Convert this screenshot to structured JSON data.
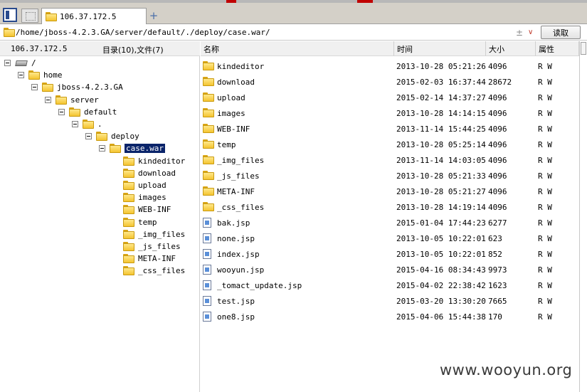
{
  "tabbar": {
    "active_tab_label": "106.37.172.5",
    "add_label": "+"
  },
  "address": {
    "path": "/home/jboss-4.2.3.GA/server/default/./deploy/case.war/",
    "pin_glyph": "±",
    "dropdown_glyph": "∨",
    "read_button_label": "读取"
  },
  "left_pane": {
    "host": "106.37.172.5",
    "counts_label": "目录(10),文件(7)",
    "tree": [
      {
        "label": "/",
        "icon": "drive-icon",
        "level": 0,
        "expander": true
      },
      {
        "label": "home",
        "icon": "folder-icon",
        "level": 1,
        "expander": true
      },
      {
        "label": "jboss-4.2.3.GA",
        "icon": "folder-icon",
        "level": 2,
        "expander": true
      },
      {
        "label": "server",
        "icon": "folder-icon",
        "level": 3,
        "expander": true
      },
      {
        "label": "default",
        "icon": "folder-icon",
        "level": 4,
        "expander": true
      },
      {
        "label": ".",
        "icon": "folder-icon",
        "level": 5,
        "expander": true
      },
      {
        "label": "deploy",
        "icon": "folder-icon",
        "level": 6,
        "expander": true
      },
      {
        "label": "case.war",
        "icon": "folder-icon",
        "level": 7,
        "expander": true,
        "selected": true
      },
      {
        "label": "kindeditor",
        "icon": "folder-icon",
        "level": 8,
        "expander": false
      },
      {
        "label": "download",
        "icon": "folder-icon",
        "level": 8,
        "expander": false
      },
      {
        "label": "upload",
        "icon": "folder-icon",
        "level": 8,
        "expander": false
      },
      {
        "label": "images",
        "icon": "folder-icon",
        "level": 8,
        "expander": false
      },
      {
        "label": "WEB-INF",
        "icon": "folder-icon",
        "level": 8,
        "expander": false
      },
      {
        "label": "temp",
        "icon": "folder-icon",
        "level": 8,
        "expander": false
      },
      {
        "label": "_img_files",
        "icon": "folder-icon",
        "level": 8,
        "expander": false
      },
      {
        "label": "_js_files",
        "icon": "folder-icon",
        "level": 8,
        "expander": false
      },
      {
        "label": "META-INF",
        "icon": "folder-icon",
        "level": 8,
        "expander": false
      },
      {
        "label": "_css_files",
        "icon": "folder-icon",
        "level": 8,
        "expander": false
      }
    ]
  },
  "file_list": {
    "columns": {
      "name": "名称",
      "time": "时间",
      "size": "大小",
      "attr": "属性"
    },
    "rows": [
      {
        "type": "folder",
        "name": "kindeditor",
        "time": "2013-10-28 05:21:26",
        "size": "4096",
        "attr": "R W"
      },
      {
        "type": "folder",
        "name": "download",
        "time": "2015-02-03 16:37:44",
        "size": "28672",
        "attr": "R W"
      },
      {
        "type": "folder",
        "name": "upload",
        "time": "2015-02-14 14:37:27",
        "size": "4096",
        "attr": "R W"
      },
      {
        "type": "folder",
        "name": "images",
        "time": "2013-10-28 14:14:15",
        "size": "4096",
        "attr": "R W"
      },
      {
        "type": "folder",
        "name": "WEB-INF",
        "time": "2013-11-14 15:44:25",
        "size": "4096",
        "attr": "R W"
      },
      {
        "type": "folder",
        "name": "temp",
        "time": "2013-10-28 05:25:14",
        "size": "4096",
        "attr": "R W"
      },
      {
        "type": "folder",
        "name": "_img_files",
        "time": "2013-11-14 14:03:05",
        "size": "4096",
        "attr": "R W"
      },
      {
        "type": "folder",
        "name": "_js_files",
        "time": "2013-10-28 05:21:33",
        "size": "4096",
        "attr": "R W"
      },
      {
        "type": "folder",
        "name": "META-INF",
        "time": "2013-10-28 05:21:27",
        "size": "4096",
        "attr": "R W"
      },
      {
        "type": "folder",
        "name": "_css_files",
        "time": "2013-10-28 14:19:14",
        "size": "4096",
        "attr": "R W"
      },
      {
        "type": "file",
        "name": "bak.jsp",
        "time": "2015-01-04 17:44:23",
        "size": "6277",
        "attr": "R W"
      },
      {
        "type": "file",
        "name": "none.jsp",
        "time": "2013-10-05 10:22:01",
        "size": "623",
        "attr": "R W"
      },
      {
        "type": "file",
        "name": "index.jsp",
        "time": "2013-10-05 10:22:01",
        "size": "852",
        "attr": "R W"
      },
      {
        "type": "file",
        "name": "wooyun.jsp",
        "time": "2015-04-16 08:34:43",
        "size": "9973",
        "attr": "R W"
      },
      {
        "type": "file",
        "name": "_tomact_update.jsp",
        "time": "2015-04-02 22:38:42",
        "size": "1623",
        "attr": "R W"
      },
      {
        "type": "file",
        "name": "test.jsp",
        "time": "2015-03-20 13:30:20",
        "size": "7665",
        "attr": "R W"
      },
      {
        "type": "file",
        "name": "one8.jsp",
        "time": "2015-04-06 15:44:38",
        "size": "170",
        "attr": "R W"
      }
    ]
  },
  "watermark": "www.wooyun.org",
  "colors": {
    "selection": "#0a246a",
    "folder": "#f4c430",
    "accent": "#2a4b8d"
  }
}
